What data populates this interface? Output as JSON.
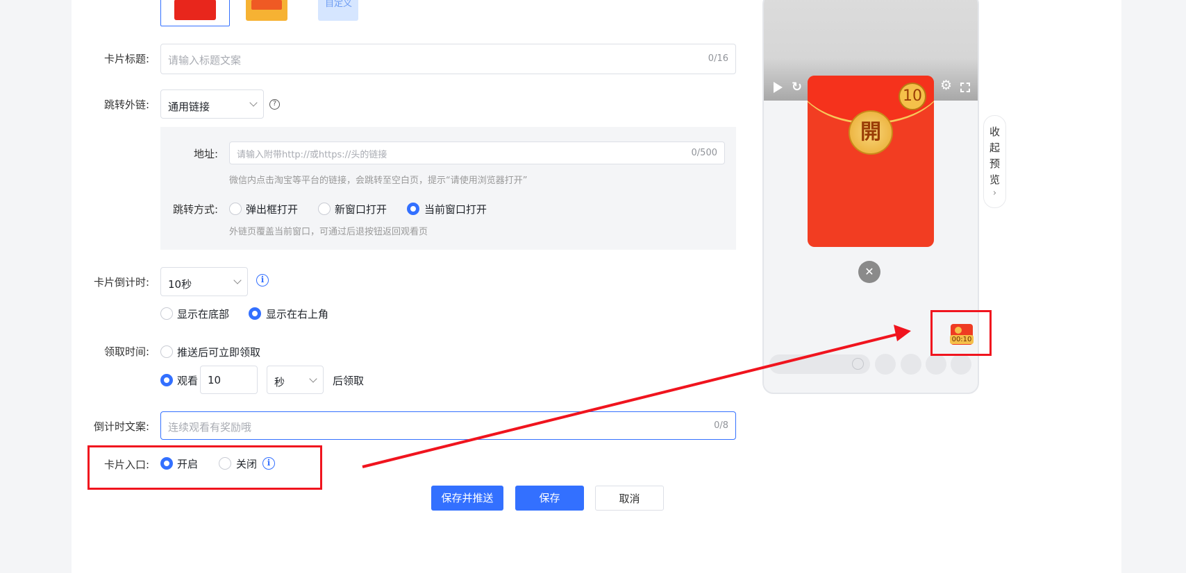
{
  "form": {
    "card_title_label": "卡片标题:",
    "card_title_placeholder": "请输入标题文案",
    "card_title_count": "0/16",
    "link_label": "跳转外链:",
    "link_type_value": "通用链接",
    "address_label": "地址:",
    "address_placeholder": "请输入附带http://或https://头的链接",
    "address_count": "0/500",
    "address_hint": "微信内点击淘宝等平台的链接，会跳转至空白页，提示“请使用浏览器打开”",
    "open_mode_label": "跳转方式:",
    "open_modes": [
      "弹出框打开",
      "新窗口打开",
      "当前窗口打开"
    ],
    "open_mode_selected": "当前窗口打开",
    "open_mode_hint": "外链页覆盖当前窗口，可通过后退按钮返回观看页",
    "countdown_label": "卡片倒计时:",
    "countdown_value": "10秒",
    "countdown_positions": [
      "显示在底部",
      "显示在右上角"
    ],
    "countdown_position_selected": "显示在右上角",
    "receive_label": "领取时间:",
    "receive_immediate": "推送后可立即领取",
    "receive_watch": "观看",
    "receive_watch_value": "10",
    "receive_unit": "秒",
    "receive_after": "后领取",
    "countdown_text_label": "倒计时文案:",
    "countdown_text_placeholder": "连续观看有奖励哦",
    "countdown_text_count": "0/8",
    "entry_label": "卡片入口:",
    "entry_on": "开启",
    "entry_off": "关闭",
    "entry_selected": "开启",
    "partial_thumb_text": "自定义"
  },
  "buttons": {
    "save_push": "保存并推送",
    "save": "保存",
    "cancel": "取消"
  },
  "preview": {
    "collapse_label": [
      "收",
      "起",
      "预",
      "览"
    ],
    "collapse_arrow": "›",
    "red_packet_open": "開",
    "red_packet_count": "10",
    "mini_timer": "00:10",
    "close_symbol": "✕"
  },
  "colors": {
    "accent": "#3370ff",
    "annotation": "#f0141e",
    "red_packet": "#f23d22",
    "gold": "#f5c04a"
  }
}
